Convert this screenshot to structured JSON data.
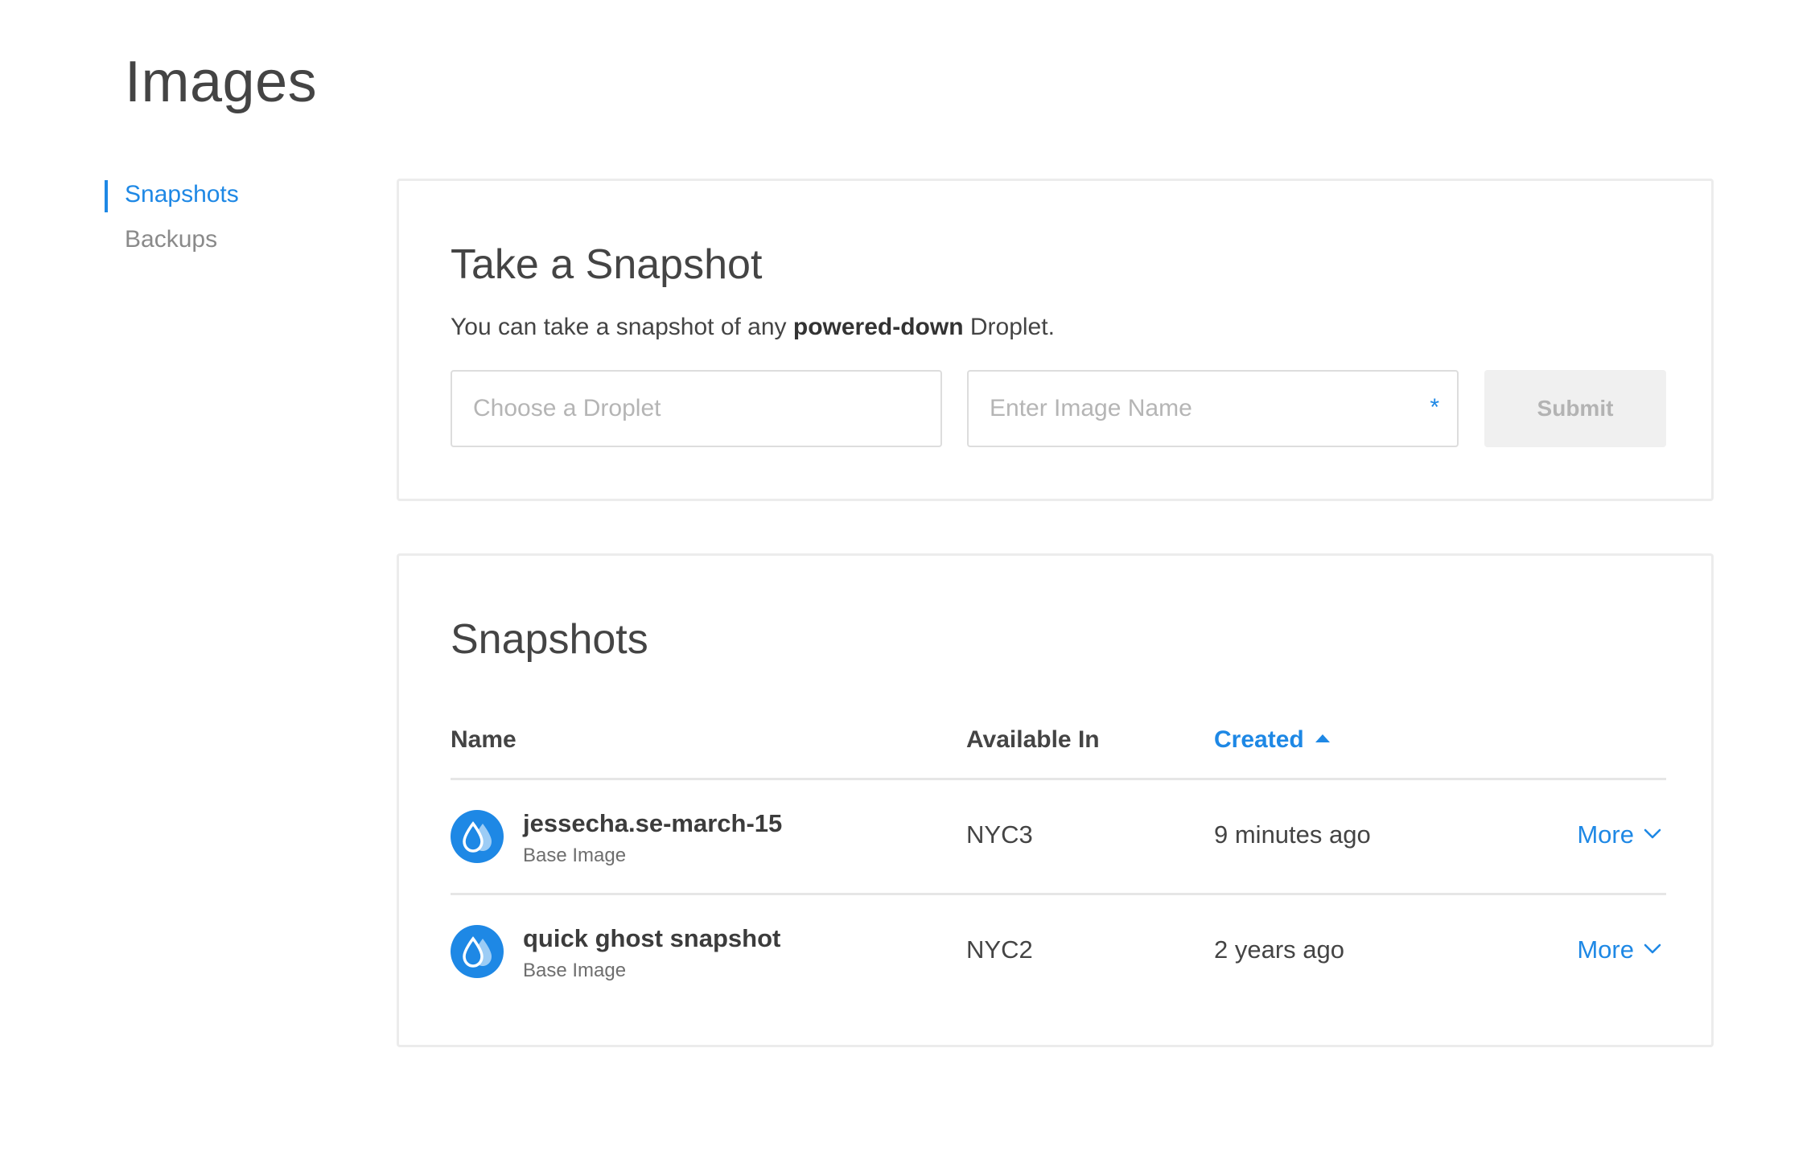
{
  "page": {
    "title": "Images"
  },
  "sidebar": {
    "items": [
      {
        "label": "Snapshots",
        "active": true
      },
      {
        "label": "Backups",
        "active": false
      }
    ]
  },
  "take_snapshot": {
    "title": "Take a Snapshot",
    "description_prefix": "You can take a snapshot of any ",
    "description_bold": "powered-down",
    "description_suffix": " Droplet.",
    "droplet_placeholder": "Choose a Droplet",
    "image_name_placeholder": "Enter Image Name",
    "required_marker": "*",
    "submit_label": "Submit"
  },
  "snapshots": {
    "title": "Snapshots",
    "columns": {
      "name": "Name",
      "available_in": "Available In",
      "created": "Created"
    },
    "sort": {
      "column": "created",
      "direction": "ascending"
    },
    "rows": [
      {
        "name": "jessecha.se-march-15",
        "type": "Base Image",
        "region": "NYC3",
        "created": "9 minutes ago",
        "action_label": "More"
      },
      {
        "name": "quick ghost snapshot",
        "type": "Base Image",
        "region": "NYC2",
        "created": "2 years ago",
        "action_label": "More"
      }
    ]
  },
  "colors": {
    "accent": "#1e88e5",
    "text": "#444444",
    "muted": "#8a8a8a",
    "border": "#ececec",
    "button_disabled_bg": "#f0f0f0"
  },
  "icons": {
    "snapshot": "droplet-icon",
    "sort": "caret-up-icon",
    "more": "chevron-down-icon"
  }
}
